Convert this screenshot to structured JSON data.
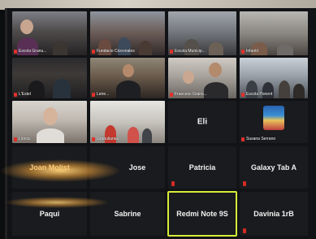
{
  "video_tiles": [
    {
      "label": "Escola Granu..."
    },
    {
      "label": "Fundacio Ciceonales"
    },
    {
      "label": "Escola Municip..."
    },
    {
      "label": "Infantil"
    },
    {
      "label": "L'Estel"
    },
    {
      "label": "Leire..."
    },
    {
      "label": "Francesc Grans..."
    },
    {
      "label": "Escola Ponent"
    },
    {
      "label": "Llorca"
    },
    {
      "label": "Granuliarius"
    },
    {
      "label": "Eli"
    },
    {
      "label": "Susana Serrano"
    }
  ],
  "name_tiles": [
    {
      "label": "Joan Molist"
    },
    {
      "label": "Jose"
    },
    {
      "label": "Patricia"
    },
    {
      "label": "Galaxy Tab A"
    },
    {
      "label": "Paqui"
    },
    {
      "label": "Sabrine"
    },
    {
      "label": "Redmi Note 9S"
    },
    {
      "label": "Davinia 1rB"
    }
  ],
  "colors": {
    "mic_muted": "#d42b25",
    "active_speaker": "#d6ee39"
  }
}
